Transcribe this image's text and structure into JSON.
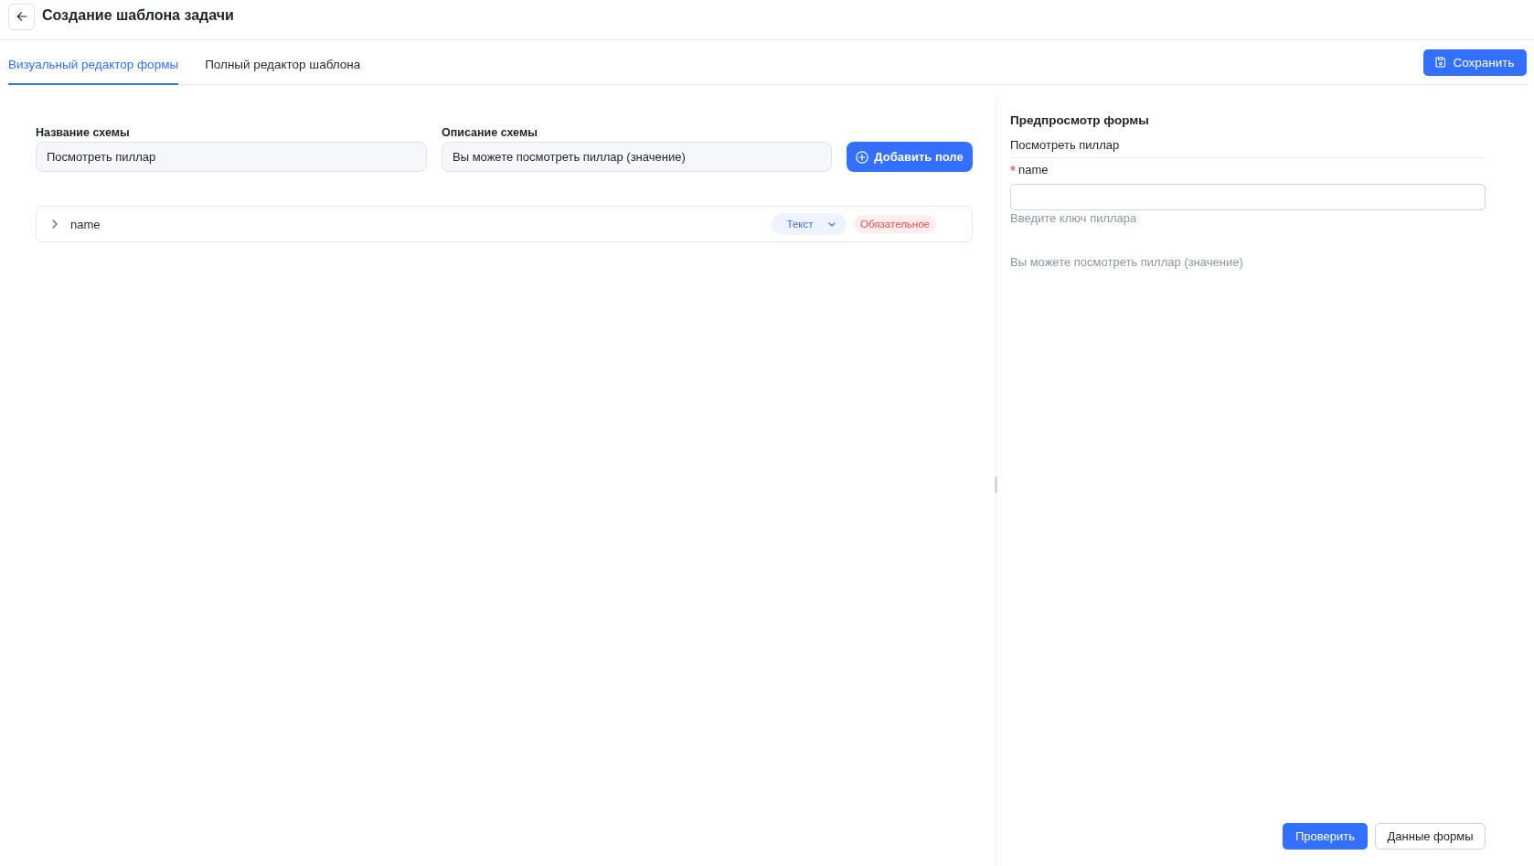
{
  "header": {
    "title": "Создание шаблона задачи"
  },
  "tabs": [
    {
      "label": "Визуальный редактор формы",
      "selected": true
    },
    {
      "label": "Полный редактор шаблона",
      "selected": false
    }
  ],
  "save_button": {
    "label": "Сохранить"
  },
  "schema": {
    "name_label": "Название схемы",
    "name_value": "Посмотреть пиллар",
    "description_label": "Описание схемы",
    "description_value": "Вы можете посмотреть пиллар (значение)",
    "add_field_button": "Добавить поле"
  },
  "fields": [
    {
      "name": "name",
      "expanded": false,
      "type": "Текст",
      "required": true,
      "required_label": "Обязательное"
    }
  ],
  "preview": {
    "title": "Предпросмотр формы",
    "form_title": "Посмотреть пиллар",
    "fields": [
      {
        "label": "name",
        "required": true,
        "help": "Введите ключ пиллара"
      }
    ],
    "description": "Вы можете посмотреть пиллар (значение)",
    "buttons": [
      {
        "label": "Проверить",
        "kind": "primary"
      },
      {
        "label": "Данные формы",
        "kind": "default"
      }
    ]
  }
}
